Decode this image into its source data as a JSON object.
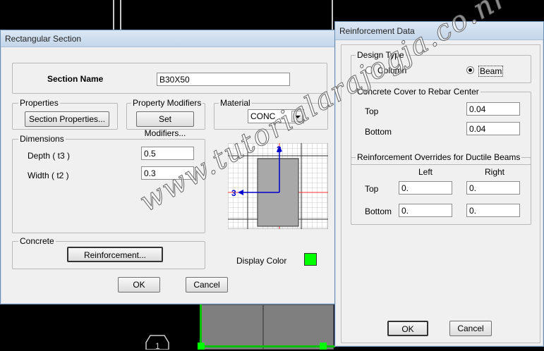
{
  "section_dialog": {
    "title": "Rectangular Section",
    "section_name_label": "Section Name",
    "section_name_value": "B30X50",
    "properties_label": "Properties",
    "section_properties_button": "Section Properties...",
    "property_modifiers_label": "Property Modifiers",
    "set_modifiers_button": "Set Modifiers...",
    "material_label": "Material",
    "material_value": "CONC",
    "dimensions_label": "Dimensions",
    "depth_label": "Depth  ( t3 )",
    "depth_value": "0.5",
    "width_label": "Width  ( t2 )",
    "width_value": "0.3",
    "concrete_label": "Concrete",
    "reinforcement_button": "Reinforcement...",
    "display_color_label": "Display Color",
    "display_color": "#00ff00",
    "axis_2_label": "2",
    "axis_3_label": "3",
    "ok_button": "OK",
    "cancel_button": "Cancel"
  },
  "reinforcement_dialog": {
    "title": "Reinforcement Data",
    "design_type_label": "Design Type",
    "column_option": "Column",
    "beam_option": "Beam",
    "selected_design_type": "Beam",
    "cover_label": "Concrete Cover to Rebar Center",
    "top_label": "Top",
    "top_cover_value": "0.04",
    "bottom_label": "Bottom",
    "bottom_cover_value": "0.04",
    "overrides_label": "Reinforcement Overrides for Ductile Beams",
    "left_header": "Left",
    "right_header": "Right",
    "override_top_label": "Top",
    "override_bottom_label": "Bottom",
    "top_left_value": "0.",
    "top_right_value": "0.",
    "bottom_left_value": "0.",
    "bottom_right_value": "0.",
    "ok_button": "OK",
    "cancel_button": "Cancel"
  },
  "watermark": "www.tutorialarajogja.co.nr",
  "background": {
    "node_label": "1"
  }
}
